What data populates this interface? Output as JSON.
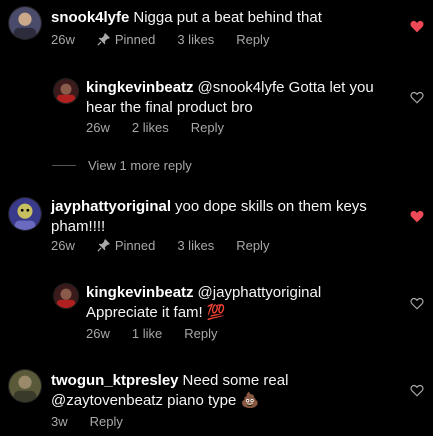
{
  "comments": [
    {
      "user": "snook4lyfe",
      "text": "Nigga put a beat behind that",
      "time": "26w",
      "pinned": "Pinned",
      "likes": "3 likes",
      "reply": "Reply",
      "liked": true
    },
    {
      "user": "kingkevinbeatz",
      "text_line1": "@snook4lyfe Gotta let you",
      "text_line2": "hear the final product bro",
      "time": "26w",
      "likes": "2 likes",
      "reply": "Reply",
      "liked": false
    },
    {
      "view_more": "View 1 more reply"
    },
    {
      "user": "jayphattyoriginal",
      "text_line1": "yoo dope skills on them keys",
      "text_line2": "pham!!!!",
      "time": "26w",
      "pinned": "Pinned",
      "likes": "3 likes",
      "reply": "Reply",
      "liked": true
    },
    {
      "user": "kingkevinbeatz",
      "text_line1": "@jayphattyoriginal",
      "text_line2": "Appreciate it fam! 💯",
      "time": "26w",
      "likes": "1 like",
      "reply": "Reply",
      "liked": false
    },
    {
      "user": "twogun_ktpresley",
      "text_line1": "Need some real",
      "text_line2": "@zaytovenbeatz piano type 💩",
      "time": "3w",
      "reply": "Reply",
      "liked": false
    }
  ],
  "colors": {
    "liked_heart": "#ed4956",
    "meta": "#a8a8a8"
  },
  "icons": {
    "pin": "pin-icon",
    "heart": "heart-icon"
  }
}
